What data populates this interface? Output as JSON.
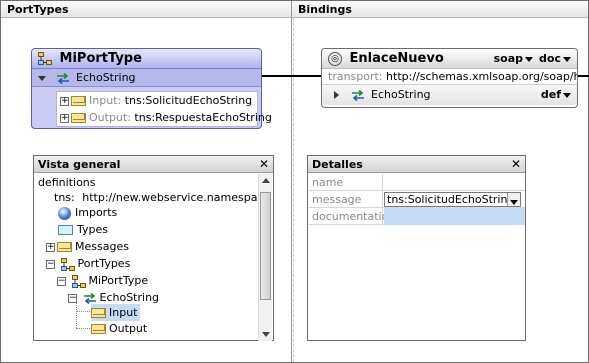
{
  "columns": {
    "port_types": "PortTypes",
    "bindings": "Bindings"
  },
  "port_type": {
    "name": "MiPortType",
    "operation": "EchoString",
    "input_label": "Input:",
    "input_value": "tns:SolicitudEchoString",
    "output_label": "Output:",
    "output_value": "tns:RespuestaEchoString"
  },
  "binding": {
    "name": "EnlaceNuevo",
    "protocol": "soap",
    "style": "doc",
    "transport_label": "transport:",
    "transport_value": "http://schemas.xmlsoap.org/soap/http",
    "operation": "EchoString",
    "operation_style": "def"
  },
  "overview": {
    "title": "Vista general",
    "close": "✕",
    "root": "definitions",
    "tns_label": "tns:",
    "tns_value": "http://new.webservice.namespace",
    "items": {
      "imports": "Imports",
      "types": "Types",
      "messages": "Messages",
      "porttypes": "PortTypes",
      "porttype": "MiPortType",
      "operation": "EchoString",
      "input": "Input",
      "output": "Output"
    }
  },
  "details": {
    "title": "Detalles",
    "close": "✕",
    "rows": {
      "name_key": "name",
      "name_value": "",
      "message_key": "message",
      "message_value": "tns:SolicitudEchoString",
      "doc_key": "documentation",
      "doc_value": ""
    }
  },
  "colors": {
    "porttype_fill": "#c9cbf3",
    "porttype_border": "#5b5fa8",
    "selection": "#c6dcf5",
    "envelope": "#f6e79a"
  }
}
